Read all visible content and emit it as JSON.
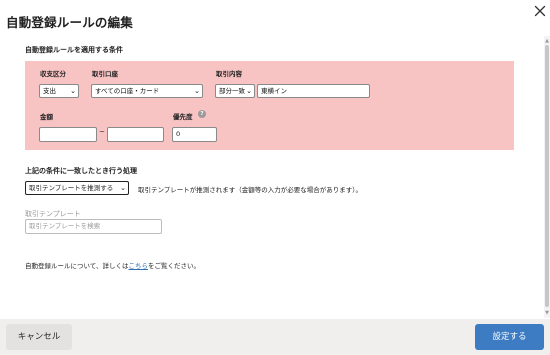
{
  "dialog": {
    "title": "自動登録ルールの編集"
  },
  "conditions": {
    "heading": "自動登録ルールを適用する条件",
    "income_expense": {
      "label": "収支区分",
      "value": "支出"
    },
    "account": {
      "label": "取引口座",
      "value": "すべての口座・カード"
    },
    "description": {
      "label": "取引内容",
      "match_value": "部分一致",
      "text_value": "東横イン"
    },
    "amount": {
      "label": "金額",
      "min_value": "",
      "max_value": "",
      "separator": "~"
    },
    "priority": {
      "label": "優先度",
      "value": "0",
      "help_glyph": "?"
    }
  },
  "action": {
    "heading": "上記の条件に一致したとき行う処理",
    "select_value": "取引テンプレートを推測する",
    "description": "取引テンプレートが推測されます（金額等の入力が必要な場合があります）。"
  },
  "template": {
    "label": "取引テンプレート",
    "search_placeholder": "取引テンプレートを検索"
  },
  "info": {
    "prefix": "自動登録ルールについて、詳しくは",
    "link": "こちら",
    "suffix": "をご覧ください。"
  },
  "footer": {
    "cancel_label": "キャンセル",
    "submit_label": "設定する"
  },
  "colors": {
    "condition_background": "#f8c3c3",
    "primary_button": "#3d7cc2",
    "link": "#2d6eb5"
  }
}
